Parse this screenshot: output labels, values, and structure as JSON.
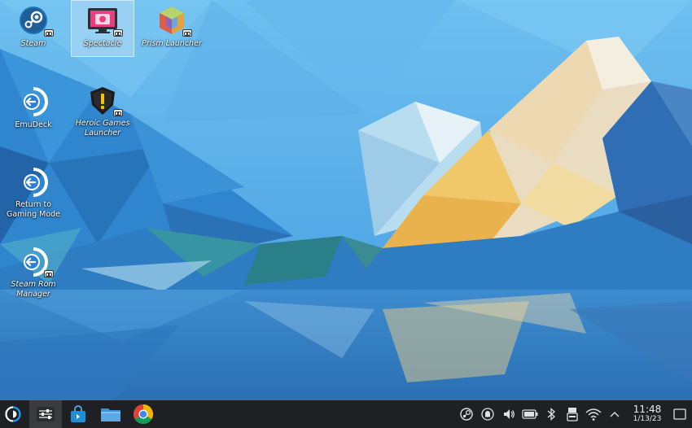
{
  "desktop": {
    "icons": [
      {
        "id": "steam",
        "label": "Steam",
        "icon": "steam-icon"
      },
      {
        "id": "spectacle",
        "label": "Spectacle",
        "icon": "spectacle-icon",
        "selected": true
      },
      {
        "id": "prism",
        "label": "Prism Launcher",
        "icon": "prism-launcher-icon"
      },
      {
        "id": "emudeck",
        "label": "EmuDeck",
        "icon": "return-arrow-icon"
      },
      {
        "id": "heroic",
        "label": "Heroic Games\nLauncher",
        "icon": "heroic-icon"
      },
      {
        "id": "gaming-mode",
        "label": "Return to\nGaming Mode",
        "icon": "return-arrow-icon"
      },
      {
        "id": "srm",
        "label": "Steam Rom\nManager",
        "icon": "return-arrow-icon"
      }
    ]
  },
  "taskbar": {
    "launchers": [
      {
        "id": "app-launcher",
        "icon": "steamdeck-logo-icon"
      },
      {
        "id": "system-settings",
        "icon": "settings-sliders-icon"
      },
      {
        "id": "discover",
        "icon": "discover-store-icon"
      },
      {
        "id": "dolphin",
        "icon": "folder-icon"
      },
      {
        "id": "chrome",
        "icon": "chrome-icon"
      }
    ],
    "tray": [
      {
        "id": "steam-tray",
        "icon": "steam-icon"
      },
      {
        "id": "ghost-tray",
        "icon": "ghost-icon"
      },
      {
        "id": "volume",
        "icon": "speaker-icon"
      },
      {
        "id": "battery",
        "icon": "battery-icon"
      },
      {
        "id": "bluetooth",
        "icon": "bluetooth-icon"
      },
      {
        "id": "storage",
        "icon": "storage-icon"
      },
      {
        "id": "wifi",
        "icon": "wifi-icon"
      },
      {
        "id": "expand",
        "icon": "chevron-up-icon"
      }
    ],
    "clock": {
      "time": "11:48",
      "date": "1/13/23"
    }
  },
  "colors": {
    "taskbar": "#1f2023",
    "steam_blue": "#1b75bb",
    "spectacle_pink": "#e93f7e",
    "heroic_yellow": "#f5c400",
    "emudeck_blue": "#2f7fd6"
  }
}
